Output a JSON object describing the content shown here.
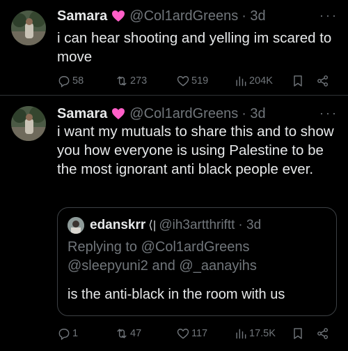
{
  "tweets": [
    {
      "author_name": "Samara",
      "handle": "@Col1ardGreens",
      "time": "· 3d",
      "text": "i can hear shooting and yelling im scared to move",
      "replies": "58",
      "retweets": "273",
      "likes": "519",
      "views": "204K"
    },
    {
      "author_name": "Samara",
      "handle": "@Col1ardGreens",
      "time": "· 3d",
      "text": "i want my mutuals to share this and to show you how everyone is using Palestine to be the most ignorant anti black people ever.",
      "quote": {
        "author_name": "edanskrr",
        "badge": "⟨|",
        "handle": "@ih3artthriftt",
        "time": "· 3d",
        "replying_to": "Replying to @Col1ardGreens @sleepyuni2 and @_aanayihs",
        "text": "is the anti-black in the room with us"
      },
      "replies": "1",
      "retweets": "47",
      "likes": "117",
      "views": "17.5K"
    }
  ],
  "colors": {
    "background": "#000000",
    "text": "#e7e9ea",
    "secondary": "#71767b",
    "heart_emoji": "#ff5fc8"
  }
}
